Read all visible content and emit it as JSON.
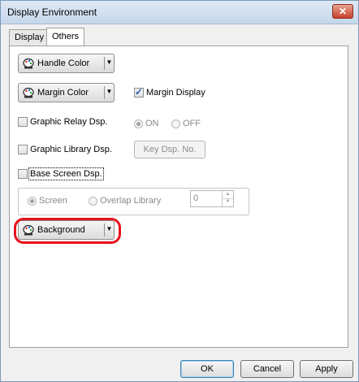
{
  "window": {
    "title": "Display Environment",
    "close_label": "✕"
  },
  "tabs": [
    {
      "label": "Display"
    },
    {
      "label": "Others"
    }
  ],
  "handle_color": {
    "label": "Handle Color"
  },
  "margin_color": {
    "label": "Margin Color"
  },
  "margin_display": {
    "label": "Margin Display",
    "checked": true
  },
  "graphic_relay": {
    "label": "Graphic Relay Dsp.",
    "checked": false,
    "on_label": "ON",
    "off_label": "OFF"
  },
  "graphic_library": {
    "label": "Graphic Library Dsp.",
    "checked": false,
    "key_button": "Key Dsp. No."
  },
  "base_screen": {
    "label": "Base Screen Dsp.",
    "checked": false
  },
  "screen_group": {
    "screen_label": "Screen",
    "overlap_label": "Overlap Library",
    "spin_value": "0"
  },
  "background": {
    "label": "Background"
  },
  "buttons": {
    "ok": "OK",
    "cancel": "Cancel",
    "apply": "Apply"
  },
  "colors": {
    "highlight": "#e8101c",
    "title_bg": "#c5d6ea",
    "checkmark": "#2a5db0"
  },
  "icons": {
    "palette": "palette-icon",
    "dropdown_arrow": "chevron-down-icon",
    "close": "close-icon"
  }
}
